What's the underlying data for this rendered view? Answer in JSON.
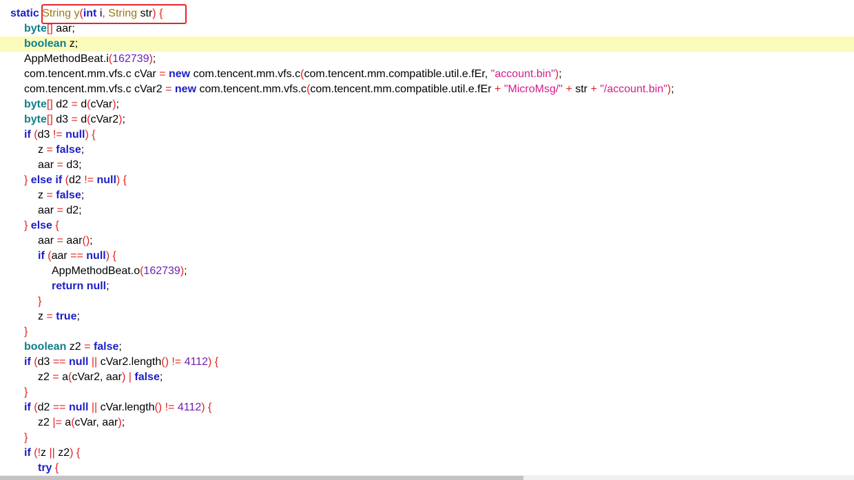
{
  "colors": {
    "keyword": "#1d1ec6",
    "type": "#11808a",
    "class": "#9a7a10",
    "string": "#d41b8a",
    "number": "#6a1fb4",
    "punct": "#e32020",
    "highlight_line": "#fbfbbc",
    "annotation_box": "#e4252a"
  },
  "code_lines": [
    {
      "indent": 1,
      "tokens": [
        [
          "k",
          "static"
        ],
        [
          "tx",
          " "
        ],
        [
          "c",
          "String"
        ],
        [
          "tx",
          " "
        ],
        [
          "c",
          "y"
        ],
        [
          "p",
          "("
        ],
        [
          "k",
          "int"
        ],
        [
          "tx",
          " i"
        ],
        [
          "p",
          ","
        ],
        [
          "tx",
          " "
        ],
        [
          "c",
          "String"
        ],
        [
          "tx",
          " str"
        ],
        [
          "p",
          ")"
        ],
        [
          "tx",
          " "
        ],
        [
          "p",
          "{"
        ]
      ]
    },
    {
      "indent": 2,
      "tokens": [
        [
          "t",
          "byte"
        ],
        [
          "p",
          "[]"
        ],
        [
          "tx",
          " aar;"
        ]
      ]
    },
    {
      "indent": 2,
      "highlight": true,
      "tokens": [
        [
          "t",
          "boolean"
        ],
        [
          "tx",
          " z;"
        ]
      ]
    },
    {
      "indent": 2,
      "tokens": [
        [
          "tx",
          "AppMethodBeat.i"
        ],
        [
          "p",
          "("
        ],
        [
          "n",
          "162739"
        ],
        [
          "p",
          ")"
        ],
        [
          "tx",
          ";"
        ]
      ]
    },
    {
      "indent": 2,
      "tokens": [
        [
          "tx",
          "com.tencent.mm.vfs.c cVar "
        ],
        [
          "p",
          "="
        ],
        [
          "tx",
          " "
        ],
        [
          "k",
          "new"
        ],
        [
          "tx",
          " com.tencent.mm.vfs.c"
        ],
        [
          "p",
          "("
        ],
        [
          "tx",
          "com.tencent.mm.compatible.util.e.fEr, "
        ],
        [
          "s",
          "\"account.bin\""
        ],
        [
          "p",
          ")"
        ],
        [
          "tx",
          ";"
        ]
      ]
    },
    {
      "indent": 2,
      "tokens": [
        [
          "tx",
          "com.tencent.mm.vfs.c cVar2 "
        ],
        [
          "p",
          "="
        ],
        [
          "tx",
          " "
        ],
        [
          "k",
          "new"
        ],
        [
          "tx",
          " com.tencent.mm.vfs.c"
        ],
        [
          "p",
          "("
        ],
        [
          "tx",
          "com.tencent.mm.compatible.util.e.fEr "
        ],
        [
          "p",
          "+"
        ],
        [
          "tx",
          " "
        ],
        [
          "s",
          "\"MicroMsg/\""
        ],
        [
          "tx",
          " "
        ],
        [
          "p",
          "+"
        ],
        [
          "tx",
          " str "
        ],
        [
          "p",
          "+"
        ],
        [
          "tx",
          " "
        ],
        [
          "s",
          "\"/account.bin\""
        ],
        [
          "p",
          ")"
        ],
        [
          "tx",
          ";"
        ]
      ]
    },
    {
      "indent": 2,
      "tokens": [
        [
          "t",
          "byte"
        ],
        [
          "p",
          "[]"
        ],
        [
          "tx",
          " d2 "
        ],
        [
          "p",
          "="
        ],
        [
          "tx",
          " d"
        ],
        [
          "p",
          "("
        ],
        [
          "tx",
          "cVar"
        ],
        [
          "p",
          ")"
        ],
        [
          "tx",
          ";"
        ]
      ]
    },
    {
      "indent": 2,
      "tokens": [
        [
          "t",
          "byte"
        ],
        [
          "p",
          "[]"
        ],
        [
          "tx",
          " d3 "
        ],
        [
          "p",
          "="
        ],
        [
          "tx",
          " d"
        ],
        [
          "p",
          "("
        ],
        [
          "tx",
          "cVar2"
        ],
        [
          "p",
          ")"
        ],
        [
          "tx",
          ";"
        ]
      ]
    },
    {
      "indent": 2,
      "tokens": [
        [
          "k",
          "if"
        ],
        [
          "tx",
          " "
        ],
        [
          "p",
          "("
        ],
        [
          "tx",
          "d3 "
        ],
        [
          "p",
          "!="
        ],
        [
          "tx",
          " "
        ],
        [
          "k",
          "null"
        ],
        [
          "p",
          ")"
        ],
        [
          "tx",
          " "
        ],
        [
          "p",
          "{"
        ]
      ]
    },
    {
      "indent": 3,
      "tokens": [
        [
          "tx",
          "z "
        ],
        [
          "p",
          "="
        ],
        [
          "tx",
          " "
        ],
        [
          "k",
          "false"
        ],
        [
          "tx",
          ";"
        ]
      ]
    },
    {
      "indent": 3,
      "tokens": [
        [
          "tx",
          "aar "
        ],
        [
          "p",
          "="
        ],
        [
          "tx",
          " d3;"
        ]
      ]
    },
    {
      "indent": 2,
      "tokens": [
        [
          "p",
          "}"
        ],
        [
          "tx",
          " "
        ],
        [
          "k",
          "else"
        ],
        [
          "tx",
          " "
        ],
        [
          "k",
          "if"
        ],
        [
          "tx",
          " "
        ],
        [
          "p",
          "("
        ],
        [
          "tx",
          "d2 "
        ],
        [
          "p",
          "!="
        ],
        [
          "tx",
          " "
        ],
        [
          "k",
          "null"
        ],
        [
          "p",
          ")"
        ],
        [
          "tx",
          " "
        ],
        [
          "p",
          "{"
        ]
      ]
    },
    {
      "indent": 3,
      "tokens": [
        [
          "tx",
          "z "
        ],
        [
          "p",
          "="
        ],
        [
          "tx",
          " "
        ],
        [
          "k",
          "false"
        ],
        [
          "tx",
          ";"
        ]
      ]
    },
    {
      "indent": 3,
      "tokens": [
        [
          "tx",
          "aar "
        ],
        [
          "p",
          "="
        ],
        [
          "tx",
          " d2;"
        ]
      ]
    },
    {
      "indent": 2,
      "tokens": [
        [
          "p",
          "}"
        ],
        [
          "tx",
          " "
        ],
        [
          "k",
          "else"
        ],
        [
          "tx",
          " "
        ],
        [
          "p",
          "{"
        ]
      ]
    },
    {
      "indent": 3,
      "tokens": [
        [
          "tx",
          "aar "
        ],
        [
          "p",
          "="
        ],
        [
          "tx",
          " aar"
        ],
        [
          "p",
          "()"
        ],
        [
          "tx",
          ";"
        ]
      ]
    },
    {
      "indent": 3,
      "tokens": [
        [
          "k",
          "if"
        ],
        [
          "tx",
          " "
        ],
        [
          "p",
          "("
        ],
        [
          "tx",
          "aar "
        ],
        [
          "p",
          "=="
        ],
        [
          "tx",
          " "
        ],
        [
          "k",
          "null"
        ],
        [
          "p",
          ")"
        ],
        [
          "tx",
          " "
        ],
        [
          "p",
          "{"
        ]
      ]
    },
    {
      "indent": 4,
      "tokens": [
        [
          "tx",
          "AppMethodBeat.o"
        ],
        [
          "p",
          "("
        ],
        [
          "n",
          "162739"
        ],
        [
          "p",
          ")"
        ],
        [
          "tx",
          ";"
        ]
      ]
    },
    {
      "indent": 4,
      "tokens": [
        [
          "k",
          "return"
        ],
        [
          "tx",
          " "
        ],
        [
          "k",
          "null"
        ],
        [
          "tx",
          ";"
        ]
      ]
    },
    {
      "indent": 3,
      "tokens": [
        [
          "p",
          "}"
        ]
      ]
    },
    {
      "indent": 3,
      "tokens": [
        [
          "tx",
          "z "
        ],
        [
          "p",
          "="
        ],
        [
          "tx",
          " "
        ],
        [
          "k",
          "true"
        ],
        [
          "tx",
          ";"
        ]
      ]
    },
    {
      "indent": 2,
      "tokens": [
        [
          "p",
          "}"
        ]
      ]
    },
    {
      "indent": 2,
      "tokens": [
        [
          "t",
          "boolean"
        ],
        [
          "tx",
          " z2 "
        ],
        [
          "p",
          "="
        ],
        [
          "tx",
          " "
        ],
        [
          "k",
          "false"
        ],
        [
          "tx",
          ";"
        ]
      ]
    },
    {
      "indent": 2,
      "tokens": [
        [
          "k",
          "if"
        ],
        [
          "tx",
          " "
        ],
        [
          "p",
          "("
        ],
        [
          "tx",
          "d3 "
        ],
        [
          "p",
          "=="
        ],
        [
          "tx",
          " "
        ],
        [
          "k",
          "null"
        ],
        [
          "tx",
          " "
        ],
        [
          "p",
          "||"
        ],
        [
          "tx",
          " cVar2.length"
        ],
        [
          "p",
          "()"
        ],
        [
          "tx",
          " "
        ],
        [
          "p",
          "!="
        ],
        [
          "tx",
          " "
        ],
        [
          "n",
          "4112"
        ],
        [
          "p",
          ")"
        ],
        [
          "tx",
          " "
        ],
        [
          "p",
          "{"
        ]
      ]
    },
    {
      "indent": 3,
      "tokens": [
        [
          "tx",
          "z2 "
        ],
        [
          "p",
          "="
        ],
        [
          "tx",
          " a"
        ],
        [
          "p",
          "("
        ],
        [
          "tx",
          "cVar2, aar"
        ],
        [
          "p",
          ")"
        ],
        [
          "tx",
          " "
        ],
        [
          "p",
          "|"
        ],
        [
          "tx",
          " "
        ],
        [
          "k",
          "false"
        ],
        [
          "tx",
          ";"
        ]
      ]
    },
    {
      "indent": 2,
      "tokens": [
        [
          "p",
          "}"
        ]
      ]
    },
    {
      "indent": 2,
      "tokens": [
        [
          "k",
          "if"
        ],
        [
          "tx",
          " "
        ],
        [
          "p",
          "("
        ],
        [
          "tx",
          "d2 "
        ],
        [
          "p",
          "=="
        ],
        [
          "tx",
          " "
        ],
        [
          "k",
          "null"
        ],
        [
          "tx",
          " "
        ],
        [
          "p",
          "||"
        ],
        [
          "tx",
          " cVar.length"
        ],
        [
          "p",
          "()"
        ],
        [
          "tx",
          " "
        ],
        [
          "p",
          "!="
        ],
        [
          "tx",
          " "
        ],
        [
          "n",
          "4112"
        ],
        [
          "p",
          ")"
        ],
        [
          "tx",
          " "
        ],
        [
          "p",
          "{"
        ]
      ]
    },
    {
      "indent": 3,
      "tokens": [
        [
          "tx",
          "z2 "
        ],
        [
          "p",
          "|="
        ],
        [
          "tx",
          " a"
        ],
        [
          "p",
          "("
        ],
        [
          "tx",
          "cVar, aar"
        ],
        [
          "p",
          ")"
        ],
        [
          "tx",
          ";"
        ]
      ]
    },
    {
      "indent": 2,
      "tokens": [
        [
          "p",
          "}"
        ]
      ]
    },
    {
      "indent": 2,
      "tokens": [
        [
          "k",
          "if"
        ],
        [
          "tx",
          " "
        ],
        [
          "p",
          "("
        ],
        [
          "p",
          "!"
        ],
        [
          "tx",
          "z "
        ],
        [
          "p",
          "||"
        ],
        [
          "tx",
          " z2"
        ],
        [
          "p",
          ")"
        ],
        [
          "tx",
          " "
        ],
        [
          "p",
          "{"
        ]
      ]
    },
    {
      "indent": 3,
      "tokens": [
        [
          "k",
          "try"
        ],
        [
          "tx",
          " "
        ],
        [
          "p",
          "{"
        ]
      ]
    }
  ]
}
